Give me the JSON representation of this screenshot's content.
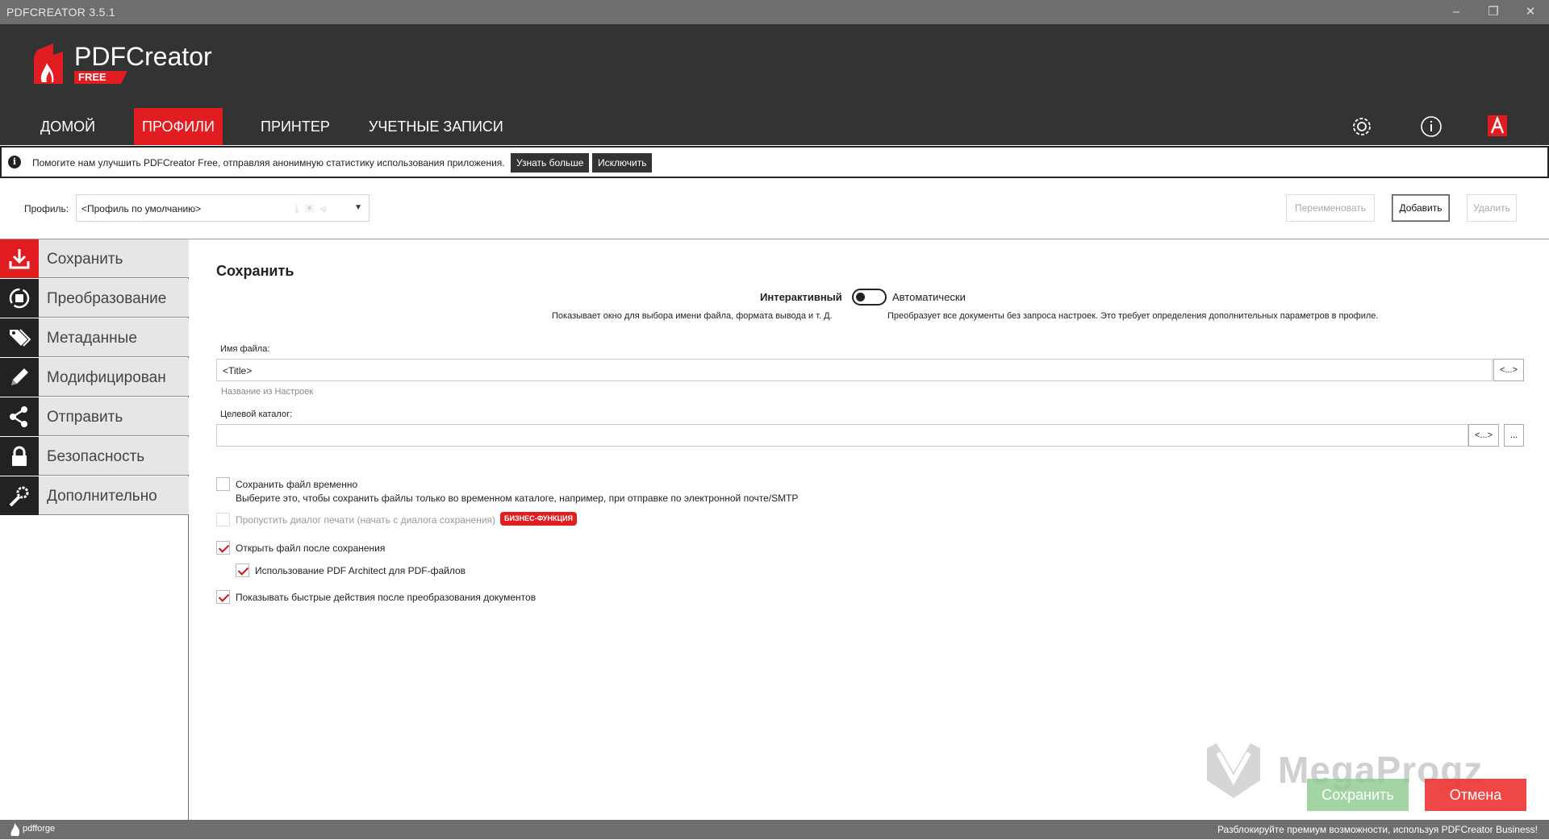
{
  "window": {
    "title": "PDFCREATOR 3.5.1"
  },
  "header": {
    "logo_text": "PDFCreator",
    "logo_badge": "FREE",
    "tabs": [
      {
        "label": "ДОМОЙ",
        "active": false
      },
      {
        "label": "ПРОФИЛИ",
        "active": true
      },
      {
        "label": "ПРИНТЕР",
        "active": false
      },
      {
        "label": "УЧЕТНЫЕ ЗАПИСИ",
        "active": false
      }
    ],
    "icons": [
      "settings-icon",
      "info-icon",
      "architect-icon"
    ]
  },
  "infobar": {
    "message": "Помогите нам улучшить PDFCreator Free, отправляя анонимную статистику использования приложения.",
    "learn_more": "Узнать больше",
    "exclude": "Исключить"
  },
  "profile": {
    "label": "Профиль:",
    "selected": "<Профиль по умолчанию>",
    "rename": "Переименовать",
    "add": "Добавить",
    "delete": "Удалить"
  },
  "sidebar": {
    "items": [
      {
        "label": "Сохранить",
        "icon": "save-icon",
        "active": true
      },
      {
        "label": "Преобразование",
        "icon": "convert-icon",
        "active": false
      },
      {
        "label": "Метаданные",
        "icon": "tags-icon",
        "active": false
      },
      {
        "label": "Модифицирован",
        "icon": "pencil-icon",
        "active": false
      },
      {
        "label": "Отправить",
        "icon": "share-icon",
        "active": false
      },
      {
        "label": "Безопасность",
        "icon": "lock-icon",
        "active": false
      },
      {
        "label": "Дополнительно",
        "icon": "wrench-gear-icon",
        "active": false
      }
    ]
  },
  "content": {
    "title": "Сохранить",
    "mode_interactive": "Интерактивный",
    "mode_auto": "Автоматически",
    "desc_interactive": "Показывает окно для выбора имени файла, формата вывода и т. Д.",
    "desc_auto": "Преобразует все документы без запроса настроек. Это требует определения дополнительных параметров в профиле.",
    "filename_label": "Имя файла:",
    "filename_value": "<Title>",
    "filename_token_btn": "<...>",
    "filename_hint": "Название из Настроек",
    "folder_label": "Целевой каталог:",
    "folder_value": "",
    "folder_token_btn": "<...>",
    "folder_browse_btn": "...",
    "options": {
      "temp_save": {
        "label": "Сохранить файл временно",
        "checked": false,
        "sub": "Выберите это, чтобы сохранить файлы только во временном каталоге, например, при отправке по электронной почте/SMTP"
      },
      "skip_print": {
        "label": "Пропустить диалог печати (начать с диалога сохранения)",
        "checked": false,
        "badge": "БИЗНЕС-ФУНКЦИЯ"
      },
      "open_after": {
        "label": "Открыть файл после сохранения",
        "checked": true
      },
      "use_architect": {
        "label": "Использование PDF Architect для PDF-файлов",
        "checked": true
      },
      "quick_actions": {
        "label": "Показывать быстрые действия после преобразования документов",
        "checked": true
      }
    }
  },
  "watermark": "MegaProgz",
  "footer": {
    "save": "Сохранить",
    "cancel": "Отмена",
    "brand": "pdfforge",
    "promo": "Разблокируйте премиум возможности, используя PDFCreator Business!"
  },
  "colors": {
    "accent": "#e11d22",
    "header_bg": "#333333",
    "titlebar_bg": "#6e6e6e"
  }
}
